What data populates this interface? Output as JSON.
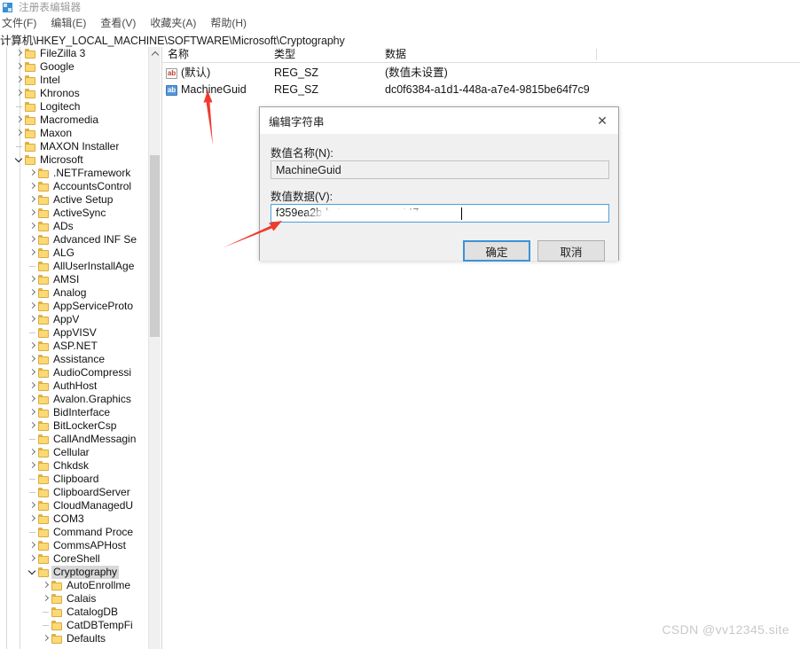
{
  "window": {
    "title": "注册表编辑器",
    "app_icon": "registry-editor-icon"
  },
  "menubar": {
    "items": [
      {
        "label": "文件(F)"
      },
      {
        "label": "编辑(E)"
      },
      {
        "label": "查看(V)"
      },
      {
        "label": "收藏夹(A)"
      },
      {
        "label": "帮助(H)"
      }
    ]
  },
  "addressbar": {
    "path": "计算机\\HKEY_LOCAL_MACHINE\\SOFTWARE\\Microsoft\\Cryptography"
  },
  "tree": {
    "items": [
      {
        "label": "FileZilla 3",
        "indent": 1,
        "state": "collapsed",
        "selected": false
      },
      {
        "label": "Google",
        "indent": 1,
        "state": "collapsed",
        "selected": false
      },
      {
        "label": "Intel",
        "indent": 1,
        "state": "collapsed",
        "selected": false
      },
      {
        "label": "Khronos",
        "indent": 1,
        "state": "collapsed",
        "selected": false
      },
      {
        "label": "Logitech",
        "indent": 1,
        "state": "leaf",
        "selected": false
      },
      {
        "label": "Macromedia",
        "indent": 1,
        "state": "collapsed",
        "selected": false
      },
      {
        "label": "Maxon",
        "indent": 1,
        "state": "collapsed",
        "selected": false
      },
      {
        "label": "MAXON Installer",
        "indent": 1,
        "state": "leaf",
        "selected": false
      },
      {
        "label": "Microsoft",
        "indent": 1,
        "state": "expanded",
        "selected": false
      },
      {
        "label": ".NETFramework",
        "indent": 2,
        "state": "collapsed",
        "selected": false
      },
      {
        "label": "AccountsControl",
        "indent": 2,
        "state": "collapsed",
        "selected": false
      },
      {
        "label": "Active Setup",
        "indent": 2,
        "state": "collapsed",
        "selected": false
      },
      {
        "label": "ActiveSync",
        "indent": 2,
        "state": "collapsed",
        "selected": false
      },
      {
        "label": "ADs",
        "indent": 2,
        "state": "collapsed",
        "selected": false
      },
      {
        "label": "Advanced INF Se",
        "indent": 2,
        "state": "collapsed",
        "selected": false
      },
      {
        "label": "ALG",
        "indent": 2,
        "state": "collapsed",
        "selected": false
      },
      {
        "label": "AllUserInstallAge",
        "indent": 2,
        "state": "leaf",
        "selected": false
      },
      {
        "label": "AMSI",
        "indent": 2,
        "state": "collapsed",
        "selected": false
      },
      {
        "label": "Analog",
        "indent": 2,
        "state": "collapsed",
        "selected": false
      },
      {
        "label": "AppServiceProto",
        "indent": 2,
        "state": "collapsed",
        "selected": false
      },
      {
        "label": "AppV",
        "indent": 2,
        "state": "collapsed",
        "selected": false
      },
      {
        "label": "AppVISV",
        "indent": 2,
        "state": "leaf",
        "selected": false
      },
      {
        "label": "ASP.NET",
        "indent": 2,
        "state": "collapsed",
        "selected": false
      },
      {
        "label": "Assistance",
        "indent": 2,
        "state": "collapsed",
        "selected": false
      },
      {
        "label": "AudioCompressi",
        "indent": 2,
        "state": "collapsed",
        "selected": false
      },
      {
        "label": "AuthHost",
        "indent": 2,
        "state": "collapsed",
        "selected": false
      },
      {
        "label": "Avalon.Graphics",
        "indent": 2,
        "state": "collapsed",
        "selected": false
      },
      {
        "label": "BidInterface",
        "indent": 2,
        "state": "collapsed",
        "selected": false
      },
      {
        "label": "BitLockerCsp",
        "indent": 2,
        "state": "collapsed",
        "selected": false
      },
      {
        "label": "CallAndMessagin",
        "indent": 2,
        "state": "leaf",
        "selected": false
      },
      {
        "label": "Cellular",
        "indent": 2,
        "state": "collapsed",
        "selected": false
      },
      {
        "label": "Chkdsk",
        "indent": 2,
        "state": "collapsed",
        "selected": false
      },
      {
        "label": "Clipboard",
        "indent": 2,
        "state": "leaf",
        "selected": false
      },
      {
        "label": "ClipboardServer",
        "indent": 2,
        "state": "leaf",
        "selected": false
      },
      {
        "label": "CloudManagedU",
        "indent": 2,
        "state": "collapsed",
        "selected": false
      },
      {
        "label": "COM3",
        "indent": 2,
        "state": "collapsed",
        "selected": false
      },
      {
        "label": "Command Proce",
        "indent": 2,
        "state": "leaf",
        "selected": false
      },
      {
        "label": "CommsAPHost",
        "indent": 2,
        "state": "collapsed",
        "selected": false
      },
      {
        "label": "CoreShell",
        "indent": 2,
        "state": "collapsed",
        "selected": false
      },
      {
        "label": "Cryptography",
        "indent": 2,
        "state": "expanded",
        "selected": true
      },
      {
        "label": "AutoEnrollme",
        "indent": 3,
        "state": "collapsed",
        "selected": false
      },
      {
        "label": "Calais",
        "indent": 3,
        "state": "collapsed",
        "selected": false
      },
      {
        "label": "CatalogDB",
        "indent": 3,
        "state": "leaf",
        "selected": false
      },
      {
        "label": "CatDBTempFi",
        "indent": 3,
        "state": "leaf",
        "selected": false
      },
      {
        "label": "Defaults",
        "indent": 3,
        "state": "collapsed",
        "selected": false
      }
    ],
    "scrollbar": {
      "up_arrow": "chevron-up-icon"
    }
  },
  "list": {
    "columns": [
      {
        "key": "name",
        "label": "名称"
      },
      {
        "key": "type",
        "label": "类型"
      },
      {
        "key": "data",
        "label": "数据"
      }
    ],
    "rows": [
      {
        "icon": "string-value-icon",
        "icon_variant": "red",
        "name": "(默认)",
        "type": "REG_SZ",
        "data": "(数值未设置)"
      },
      {
        "icon": "string-value-icon",
        "icon_variant": "blue",
        "name": "MachineGuid",
        "type": "REG_SZ",
        "data": "dc0f6384-a1d1-448a-a7e4-9815be64f7c9"
      }
    ]
  },
  "dialog": {
    "title": "编辑字符串",
    "close_icon": "close-icon",
    "name_label": "数值名称(N):",
    "name_value": "MachineGuid",
    "data_label": "数值数据(V):",
    "data_value": "f359ea2b-b           4-19267b2a8447",
    "data_value_prefix": "f359ea2b-b",
    "data_value_suffix": "4-19267b2a8447",
    "ok_label": "确定",
    "cancel_label": "取消"
  },
  "annotations": {
    "arrow_color": "#f03a2e",
    "arrow_1": "red-arrow-pointing-to-machineguid",
    "arrow_2": "red-arrow-pointing-to-value-data-field"
  },
  "watermark": {
    "text": "CSDN @vv12345.site"
  }
}
